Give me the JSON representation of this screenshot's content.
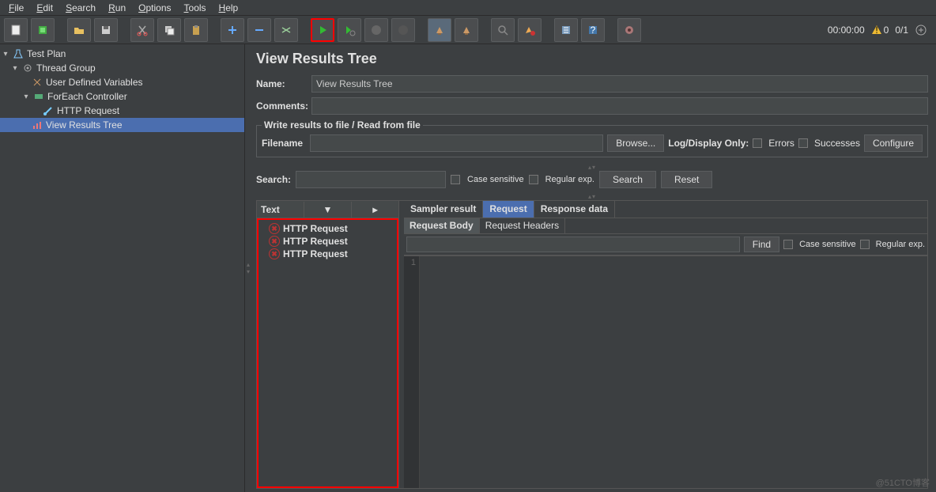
{
  "menu": [
    "File",
    "Edit",
    "Search",
    "Run",
    "Options",
    "Tools",
    "Help"
  ],
  "toolbar_right": {
    "time": "00:00:00",
    "warn_count": "0",
    "active": "0/1"
  },
  "tree": {
    "root": "Test Plan",
    "thread_group": "Thread Group",
    "udv": "User Defined Variables",
    "foreach": "ForEach Controller",
    "http": "HTTP Request",
    "vrt": "View Results Tree"
  },
  "panel": {
    "title": "View Results Tree",
    "name_label": "Name:",
    "name_value": "View Results Tree",
    "comments_label": "Comments:",
    "comments_value": "",
    "fieldset_legend": "Write results to file / Read from file",
    "filename_label": "Filename",
    "filename_value": "",
    "browse": "Browse...",
    "logdisplay": "Log/Display Only:",
    "errors": "Errors",
    "successes": "Successes",
    "configure": "Configure",
    "search_label": "Search:",
    "case_sensitive": "Case sensitive",
    "regex": "Regular exp.",
    "search_btn": "Search",
    "reset_btn": "Reset",
    "renderer": "Text",
    "results": [
      "HTTP Request",
      "HTTP Request",
      "HTTP Request"
    ],
    "tabs": {
      "sampler": "Sampler result",
      "request": "Request",
      "response": "Response data"
    },
    "subtabs": {
      "body": "Request Body",
      "headers": "Request Headers"
    },
    "find": "Find",
    "find_cs": "Case sensitive",
    "find_re": "Regular exp.",
    "line1": "1"
  },
  "watermark": "@51CTO博客"
}
